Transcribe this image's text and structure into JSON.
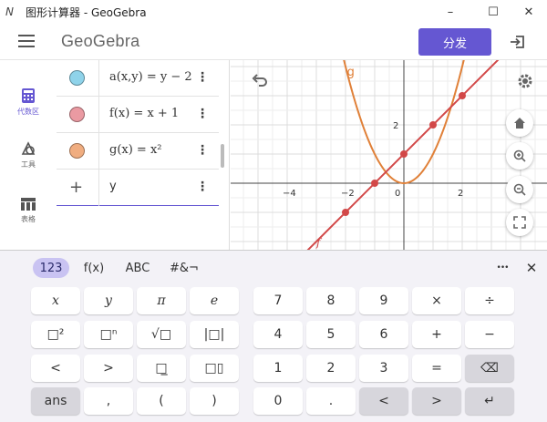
{
  "window": {
    "title": "图形计算器 - GeoGebra",
    "minimize": "–",
    "maximize": "☐",
    "close": "✕"
  },
  "header": {
    "brand": "GeoGebra",
    "share_label": "分发"
  },
  "nav": {
    "items": [
      {
        "label": "代数区",
        "icon": "calculator-icon",
        "active": true
      },
      {
        "label": "工具",
        "icon": "shapes-icon",
        "active": false
      },
      {
        "label": "表格",
        "icon": "table-icon",
        "active": false
      }
    ]
  },
  "algebra": {
    "rows": [
      {
        "expr": "a(x,y) = y − 2",
        "color": "#8fd3ea"
      },
      {
        "expr": "f(x) = x + 1",
        "color": "#ea9aa2"
      },
      {
        "expr": "g(x) = x²",
        "color": "#f0ad80"
      }
    ],
    "input": {
      "plus": "+",
      "value": "y"
    }
  },
  "graph": {
    "x_ticks": [
      "−4",
      "−2",
      "0",
      "2"
    ],
    "y_ticks": [
      "2"
    ],
    "curve_labels": {
      "g": "g",
      "f": "f"
    },
    "line_color": "#d24848",
    "parabola_color": "#e08038"
  },
  "keyboard": {
    "tabs": [
      "123",
      "f(x)",
      "ABC",
      "#&¬"
    ],
    "more": "•••",
    "close": "✕",
    "left_keys": [
      [
        "x",
        "y",
        "π",
        "e"
      ],
      [
        "□²",
        "□ⁿ",
        "√□",
        "|□|"
      ],
      [
        "<",
        ">",
        "□̲",
        "□▯"
      ],
      [
        "ans",
        ",",
        "(",
        ")"
      ]
    ],
    "right_keys": [
      [
        "7",
        "8",
        "9",
        "×",
        "÷"
      ],
      [
        "4",
        "5",
        "6",
        "+",
        "−"
      ],
      [
        "1",
        "2",
        "3",
        "=",
        "⌫"
      ],
      [
        "0",
        ".",
        "<",
        ">",
        "↵"
      ]
    ]
  }
}
